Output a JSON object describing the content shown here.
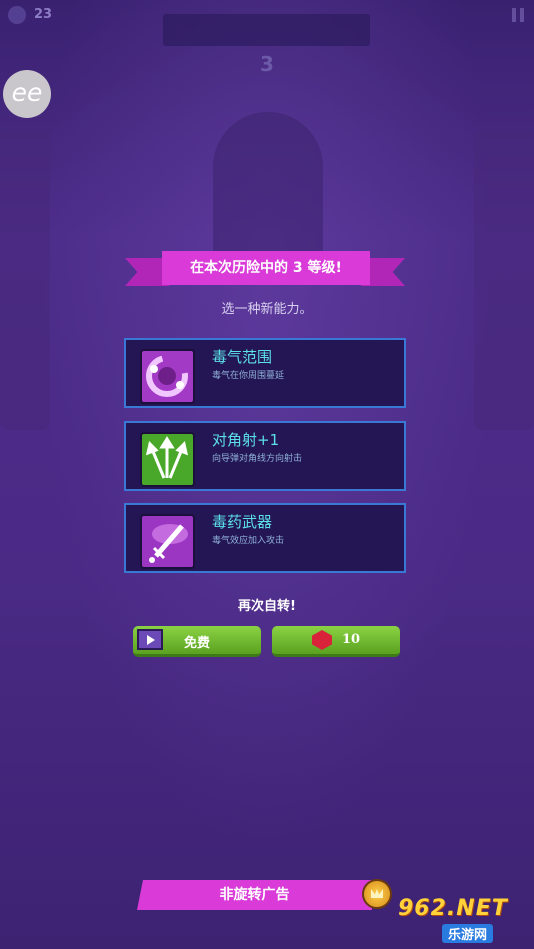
{
  "hud": {
    "coin_count": "23",
    "stage_number": "3",
    "coin_icon": "coin-icon",
    "pause_icon": "pause-icon"
  },
  "overlay_logo": {
    "text": "ee"
  },
  "level_up": {
    "banner": "在本次历险中的 3 等级!",
    "subtitle": "选一种新能力。"
  },
  "abilities": [
    {
      "name": "毒气范围",
      "description": "毒气在你周围蔓延",
      "icon": "poison-cloud-icon",
      "icon_color": "#a33ac6"
    },
    {
      "name": "对角射+1",
      "description": "向导弹对角线方向射击",
      "icon": "diagonal-arrows-icon",
      "icon_color": "#49a82a"
    },
    {
      "name": "毒药武器",
      "description": "毒气效应加入攻击",
      "icon": "poison-sword-icon",
      "icon_color": "#9b36c2"
    }
  ],
  "reroll": {
    "title": "再次自转!",
    "free_label": "免费",
    "gem_cost": "10"
  },
  "ad": {
    "label": "非旋转广告"
  },
  "watermark": {
    "main": "962.NET",
    "sub": "乐游网"
  },
  "colors": {
    "background": "#4a2a86",
    "banner": "#d93ad8",
    "card_border": "#3a78d6",
    "ability_name": "#5be0e8",
    "button_green": "#6bb52c"
  }
}
